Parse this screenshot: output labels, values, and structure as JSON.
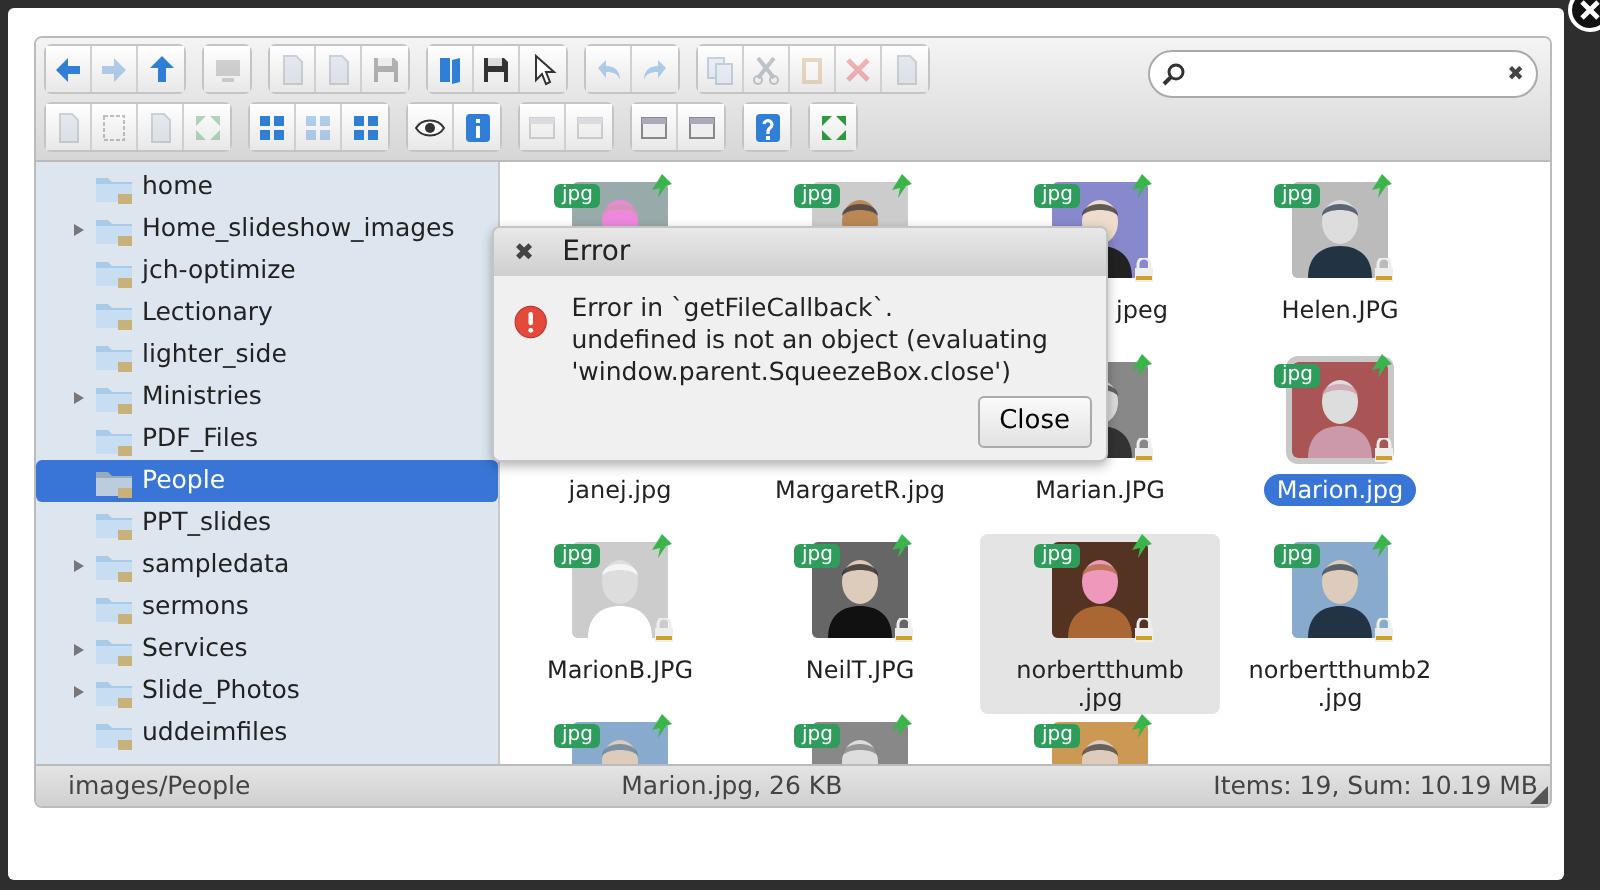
{
  "toolbar": {
    "rows": [
      [
        [
          {
            "kind": "back",
            "disabled": false
          },
          {
            "kind": "forward",
            "disabled": true
          },
          {
            "kind": "up",
            "disabled": false
          }
        ],
        [
          {
            "kind": "monitor",
            "disabled": true
          }
        ],
        [
          {
            "kind": "document",
            "disabled": true
          },
          {
            "kind": "document",
            "disabled": true
          },
          {
            "kind": "save",
            "disabled": true
          }
        ],
        [
          {
            "kind": "book",
            "disabled": false
          },
          {
            "kind": "save",
            "disabled": false
          },
          {
            "kind": "pointer",
            "disabled": false
          }
        ],
        [
          {
            "kind": "undo",
            "disabled": true
          },
          {
            "kind": "redo",
            "disabled": true
          }
        ],
        [
          {
            "kind": "copy",
            "disabled": true
          },
          {
            "kind": "scissors",
            "disabled": true
          },
          {
            "kind": "clipboard",
            "disabled": true
          },
          {
            "kind": "delete",
            "disabled": true
          },
          {
            "kind": "document",
            "disabled": true
          }
        ]
      ],
      [
        [
          {
            "kind": "document",
            "disabled": true
          },
          {
            "kind": "frame",
            "disabled": true
          },
          {
            "kind": "document",
            "disabled": true
          },
          {
            "kind": "expand",
            "disabled": true
          }
        ],
        [
          {
            "kind": "grid",
            "disabled": false
          },
          {
            "kind": "grid",
            "disabled": true
          },
          {
            "kind": "grid",
            "disabled": false
          }
        ],
        [
          {
            "kind": "eye",
            "disabled": false
          },
          {
            "kind": "info",
            "disabled": false
          }
        ],
        [
          {
            "kind": "window",
            "disabled": true
          },
          {
            "kind": "window",
            "disabled": true
          }
        ],
        [
          {
            "kind": "window",
            "disabled": false
          },
          {
            "kind": "window",
            "disabled": false
          }
        ],
        [
          {
            "kind": "help",
            "disabled": false
          }
        ],
        [
          {
            "kind": "expand",
            "disabled": false
          }
        ]
      ]
    ]
  },
  "search": {
    "clear": "✖"
  },
  "sidebar": {
    "items": [
      {
        "label": "home",
        "expandable": false,
        "selected": false
      },
      {
        "label": "Home_slideshow_images",
        "expandable": true,
        "selected": false
      },
      {
        "label": "jch-optimize",
        "expandable": false,
        "selected": false
      },
      {
        "label": "Lectionary",
        "expandable": false,
        "selected": false
      },
      {
        "label": "lighter_side",
        "expandable": false,
        "selected": false
      },
      {
        "label": "Ministries",
        "expandable": true,
        "selected": false
      },
      {
        "label": "PDF_Files",
        "expandable": false,
        "selected": false
      },
      {
        "label": "People",
        "expandable": false,
        "selected": true
      },
      {
        "label": "PPT_slides",
        "expandable": false,
        "selected": false
      },
      {
        "label": "sampledata",
        "expandable": true,
        "selected": false
      },
      {
        "label": "sermons",
        "expandable": false,
        "selected": false
      },
      {
        "label": "Services",
        "expandable": true,
        "selected": false
      },
      {
        "label": "Slide_Photos",
        "expandable": true,
        "selected": false
      },
      {
        "label": "uddeimfiles",
        "expandable": false,
        "selected": false
      }
    ]
  },
  "files": [
    {
      "badge": "jpg",
      "selected": false,
      "hovered": false
    },
    {
      "badge": "jpg",
      "selected": false,
      "hovered": false
    },
    {
      "badge": "jpg",
      "name": "jpeg",
      "name_cut": true,
      "selected": false,
      "hovered": false
    },
    {
      "badge": "jpg",
      "name": "Helen.JPG",
      "selected": false,
      "hovered": false
    },
    {
      "name": "janej.jpg",
      "selected": false,
      "hovered": false
    },
    {
      "name": "MargaretR.jpg",
      "selected": false,
      "hovered": false
    },
    {
      "name": "Marian.JPG",
      "selected": false,
      "hovered": false
    },
    {
      "badge": "jpg",
      "name": "Marion.jpg",
      "selected": true,
      "hovered": false
    },
    {
      "badge": "jpg",
      "name": "MarionB.JPG",
      "selected": false,
      "hovered": false
    },
    {
      "badge": "jpg",
      "name": "NeilT.JPG",
      "selected": false,
      "hovered": false
    },
    {
      "badge": "jpg",
      "name": "norbertthumb.jpg",
      "selected": false,
      "hovered": true
    },
    {
      "badge": "jpg",
      "name": "norbertthumb2.jpg",
      "selected": false,
      "hovered": false
    },
    {
      "badge": "jpg",
      "selected": false,
      "hovered": false
    },
    {
      "badge": "jpg",
      "selected": false,
      "hovered": false
    },
    {
      "badge": "jpg",
      "selected": false,
      "hovered": false
    }
  ],
  "status_bar": {
    "path": "images/People",
    "selection": "Marion.jpg, 26 KB",
    "summary": "Items: 19, Sum: 10.19 MB"
  },
  "dialog": {
    "title": "Error",
    "close": "✖",
    "message": [
      "Error in `getFileCallback`.",
      "undefined is not an object (evaluating 'window.parent.SqueezeBox.close')"
    ],
    "button": "Close"
  }
}
